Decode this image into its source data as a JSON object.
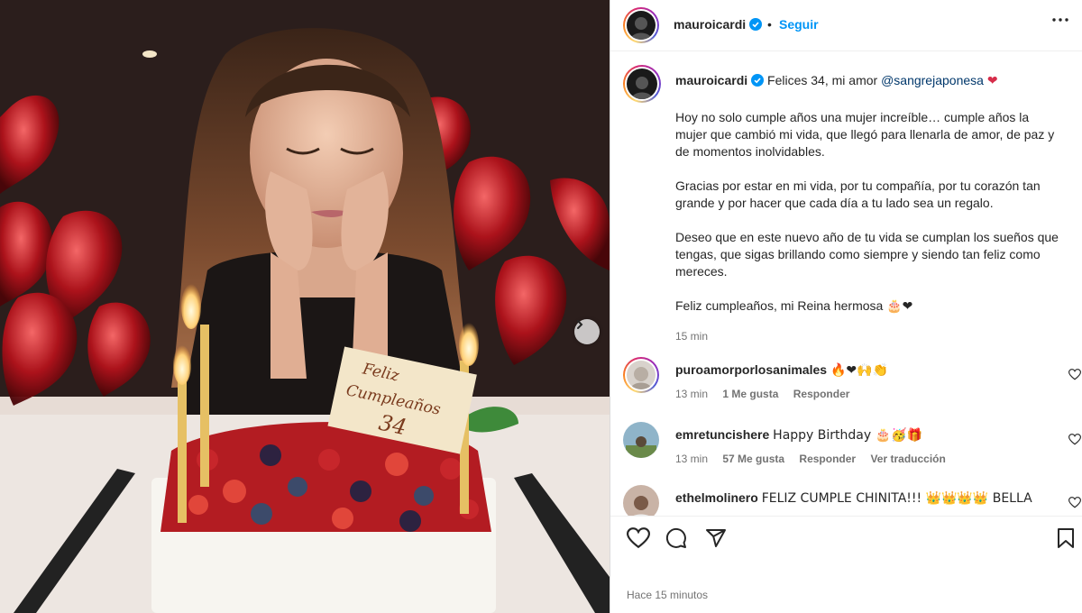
{
  "post": {
    "photo_cake_text_line1": "Feliz",
    "photo_cake_text_line2": "Cumpleaños",
    "photo_cake_text_line3": "34"
  },
  "header": {
    "username": "mauroicardi",
    "separator": "•",
    "follow_label": "Seguir"
  },
  "caption": {
    "username": "mauroicardi",
    "first_line_text": "Felices 34, mi amor",
    "mention": "@sangrejaponesa",
    "first_line_emoji": "❤",
    "paragraphs": [
      "Hoy no solo cumple años una mujer increíble… cumple años la mujer que cambió mi vida, que llegó para llenarla de amor, de paz y de momentos inolvidables.",
      "Gracias por estar en mi vida, por tu compañía, por tu corazón tan grande y por hacer que cada día a tu lado sea un regalo.",
      "Deseo que en este nuevo año de tu vida se cumplan los sueños que tengas, que sigas brillando como siempre y siendo tan feliz como mereces.",
      "Feliz cumpleaños, mi Reina hermosa 🎂❤"
    ],
    "time": "15 min"
  },
  "comments": [
    {
      "username": "puroamorporlosanimales",
      "text": "🔥❤🙌👏",
      "time": "13 min",
      "likes": "1 Me gusta",
      "reply": "Responder",
      "translate": ""
    },
    {
      "username": "emretuncishere",
      "text": "Happy Birthday 🎂🥳🎁",
      "time": "13 min",
      "likes": "57 Me gusta",
      "reply": "Responder",
      "translate": "Ver traducción"
    },
    {
      "username": "ethelmolinero",
      "text": "FELIZ CUMPLE CHINITA!!! 👑👑👑👑 BELLA",
      "time": "",
      "likes": "",
      "reply": "",
      "translate": ""
    }
  ],
  "footer": {
    "posted_ago": "Hace 15 minutos"
  },
  "icons": {
    "like": "heart-icon",
    "comment": "comment-icon",
    "share": "share-icon",
    "save": "bookmark-icon",
    "more": "more-options-icon",
    "next": "chevron-right-icon",
    "verified": "verified-badge-icon"
  },
  "colors": {
    "link_blue": "#0095f6",
    "mention_blue": "#00376b",
    "secondary_text": "#737373",
    "verified_blue": "#0095f6"
  }
}
